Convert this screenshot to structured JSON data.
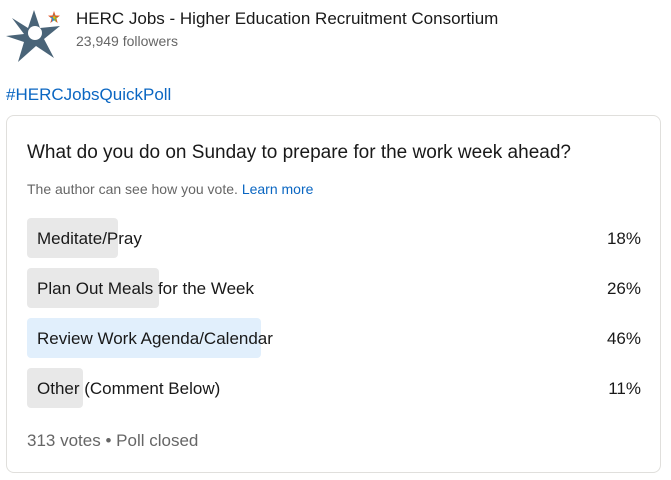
{
  "post": {
    "author": "HERC Jobs - Higher Education Recruitment Consortium",
    "followers": "23,949 followers",
    "hashtag": "#HERCJobsQuickPoll"
  },
  "poll": {
    "question": "What do you do on Sunday to prepare for the work week ahead?",
    "privacy_note": "The author can see how you vote.",
    "learn_more": "Learn more",
    "options": [
      {
        "label": "Meditate/Pray",
        "percent_text": "18%",
        "percent": 18,
        "selected": false
      },
      {
        "label": "Plan Out Meals for the Week",
        "percent_text": "26%",
        "percent": 26,
        "selected": false
      },
      {
        "label": "Review Work Agenda/Calendar",
        "percent_text": "46%",
        "percent": 46,
        "selected": true
      },
      {
        "label": "Other (Comment Below)",
        "percent_text": "11%",
        "percent": 11,
        "selected": false
      }
    ],
    "votes": "313 votes",
    "status": "Poll closed"
  },
  "colors": {
    "link": "#0a66c2",
    "bar": "#e8e8e8",
    "bar_selected": "#e1effc",
    "logo_star": "#4a6478"
  },
  "icons": {
    "logo": "herc-star-logo"
  }
}
